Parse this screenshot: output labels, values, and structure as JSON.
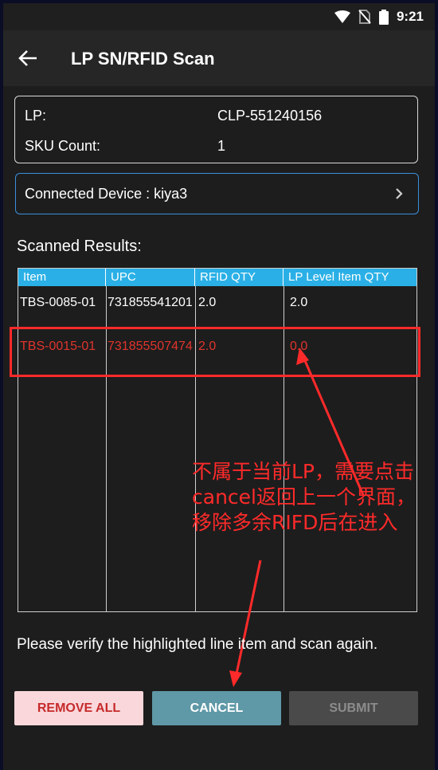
{
  "status_bar": {
    "time": "9:21",
    "icons": [
      "wifi-icon",
      "no-sim-icon",
      "battery-icon"
    ]
  },
  "app_bar": {
    "title": "LP SN/RFID Scan",
    "back_icon": "arrow-left-icon"
  },
  "lp_info": {
    "lp_label": "LP:",
    "lp_value": "CLP-551240156",
    "sku_label": "SKU Count:",
    "sku_value": "1"
  },
  "device": {
    "label": "Connected Device : kiya3",
    "chevron_icon": "chevron-right-icon"
  },
  "results": {
    "title": "Scanned Results:",
    "columns": [
      "Item",
      "UPC",
      "RFID QTY",
      "LP Level Item QTY"
    ],
    "rows": [
      {
        "item": "TBS-0085-01",
        "upc": "731855541201",
        "rfid_qty": "2.0",
        "lp_qty": "2.0",
        "highlighted": false
      },
      {
        "item": "TBS-0015-01",
        "upc": "731855507474",
        "rfid_qty": "2.0",
        "lp_qty": "0.0",
        "highlighted": true
      }
    ]
  },
  "annotation": {
    "text": "不属于当前LP，需要点击cancel返回上一个界面，移除多余RIFD后在进入"
  },
  "message": "Please verify the highlighted line item and scan again.",
  "buttons": {
    "remove_all": "REMOVE ALL",
    "cancel": "CANCEL",
    "submit": "SUBMIT"
  },
  "colors": {
    "header_blue": "#2ab0e6",
    "error_red": "#e0342c",
    "annotation_red": "#ff2a2a",
    "cancel_teal": "#5f98a6",
    "remove_pink": "#f9d7db"
  }
}
